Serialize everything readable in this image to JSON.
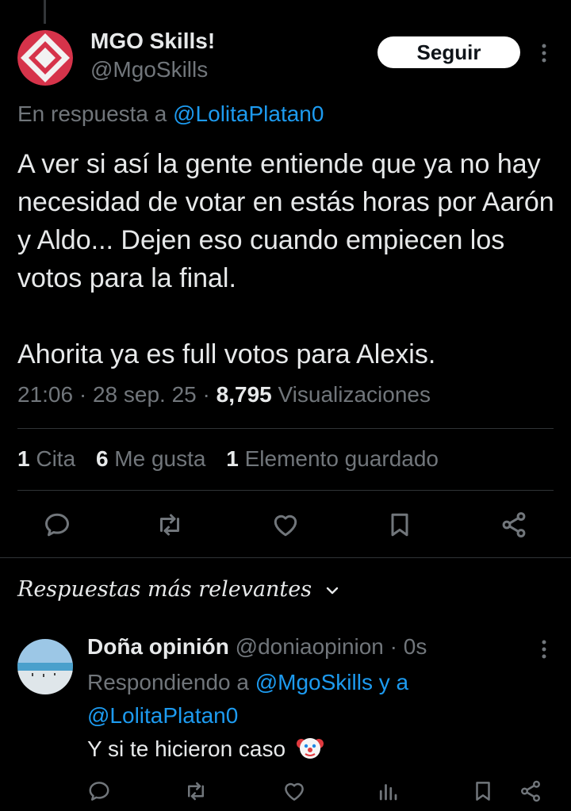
{
  "tweet": {
    "author_name": "MGO Skills!",
    "author_handle": "@MgoSkills",
    "follow_label": "Seguir",
    "reply_prefix": "En respuesta a",
    "reply_target": "@LolitaPlatan0",
    "paragraph_1": "A ver si así la gente entiende que ya no hay necesidad de votar en estás horas por Aarón y Aldo... Dejen eso cuando empiecen los votos para la final.",
    "paragraph_2": "Ahorita ya es full votos para Alexis.",
    "time": "21:06",
    "date": "28 sep. 25",
    "views_count": "8,795",
    "views_label": "Visualizaciones",
    "quotes_count": "1",
    "quotes_label": "Cita",
    "likes_count": "6",
    "likes_label": "Me gusta",
    "bookmarks_count": "1",
    "bookmarks_label": "Elemento guardado"
  },
  "sort": {
    "label": "Respuestas más relevantes"
  },
  "reply": {
    "name": "Doña opinión",
    "handle": "@doniaopinion",
    "time": "0s",
    "replying_prefix": "Respondiendo a",
    "replying_target_1": "@MgoSkills",
    "replying_and": "y a",
    "replying_target_2": "@LolitaPlatan0",
    "text": "Y si te hicieron caso"
  },
  "icons": {
    "reply": "reply-icon",
    "retweet": "retweet-icon",
    "like": "heart-icon",
    "bookmark": "bookmark-icon",
    "share": "share-icon",
    "views": "views-icon",
    "more": "more-icon",
    "clown": "clown-emoji"
  },
  "colors": {
    "background": "#000000",
    "text": "#e7e9ea",
    "muted": "#71767b",
    "link": "#1d9bf0",
    "divider": "#2f3336"
  }
}
